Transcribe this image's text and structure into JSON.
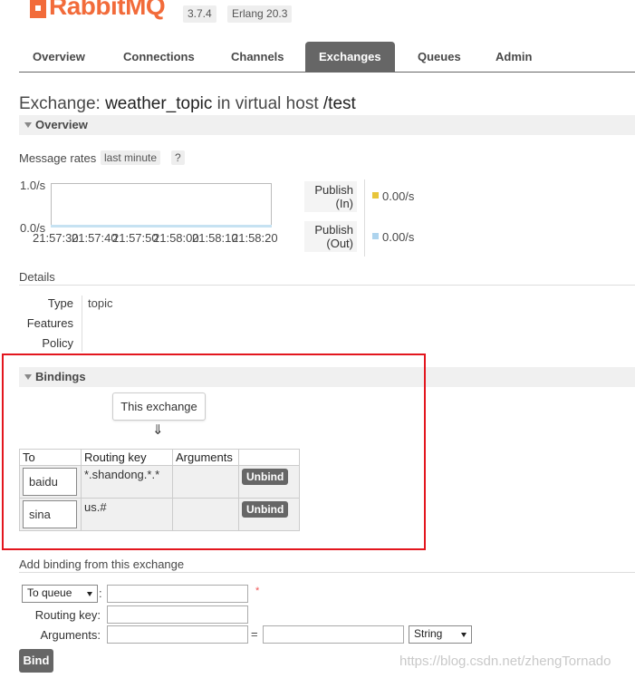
{
  "header": {
    "logo_text": "RabbitMQ",
    "version": "3.7.4",
    "erlang": "Erlang 20.3"
  },
  "nav": {
    "tabs": [
      {
        "label": "Overview"
      },
      {
        "label": "Connections"
      },
      {
        "label": "Channels"
      },
      {
        "label": "Exchanges",
        "active": true
      },
      {
        "label": "Queues"
      },
      {
        "label": "Admin"
      }
    ]
  },
  "page": {
    "title_prefix": "Exchange:",
    "exchange_name": "weather_topic",
    "title_mid": "in virtual host",
    "vhost": "/test"
  },
  "overview": {
    "header": "Overview",
    "message_rates_label": "Message rates",
    "range": "last minute",
    "help": "?",
    "chart": {
      "y_top": "1.0/s",
      "y_bottom": "0.0/s",
      "x_ticks": [
        "21:57:30",
        "21:57:40",
        "21:57:50",
        "21:58:00",
        "21:58:10",
        "21:58:20"
      ]
    },
    "rates": [
      {
        "line1": "Publish",
        "line2": "(In)",
        "value": "0.00/s",
        "color": "#e8c53a"
      },
      {
        "line1": "Publish",
        "line2": "(Out)",
        "value": "0.00/s",
        "color": "#aed4ee"
      }
    ]
  },
  "details": {
    "header": "Details",
    "rows": [
      {
        "key": "Type",
        "value": "topic"
      },
      {
        "key": "Features",
        "value": ""
      },
      {
        "key": "Policy",
        "value": ""
      }
    ]
  },
  "bindings": {
    "header": "Bindings",
    "this_exchange": "This exchange",
    "arrow": "⇓",
    "columns": [
      "To",
      "Routing key",
      "Arguments",
      ""
    ],
    "rows": [
      {
        "to": "baidu",
        "routing_key": "*.shandong.*.*",
        "arguments": "",
        "action": "Unbind"
      },
      {
        "to": "sina",
        "routing_key": "us.#",
        "arguments": "",
        "action": "Unbind"
      }
    ]
  },
  "add_binding": {
    "header": "Add binding from this exchange",
    "destination_type": "To queue",
    "colon": ":",
    "required_mark": "*",
    "routing_key_label": "Routing key:",
    "arguments_label": "Arguments:",
    "equals": "=",
    "arg_type": "String",
    "bind_label": "Bind"
  },
  "watermark": "https://blog.csdn.net/zhengTornado"
}
